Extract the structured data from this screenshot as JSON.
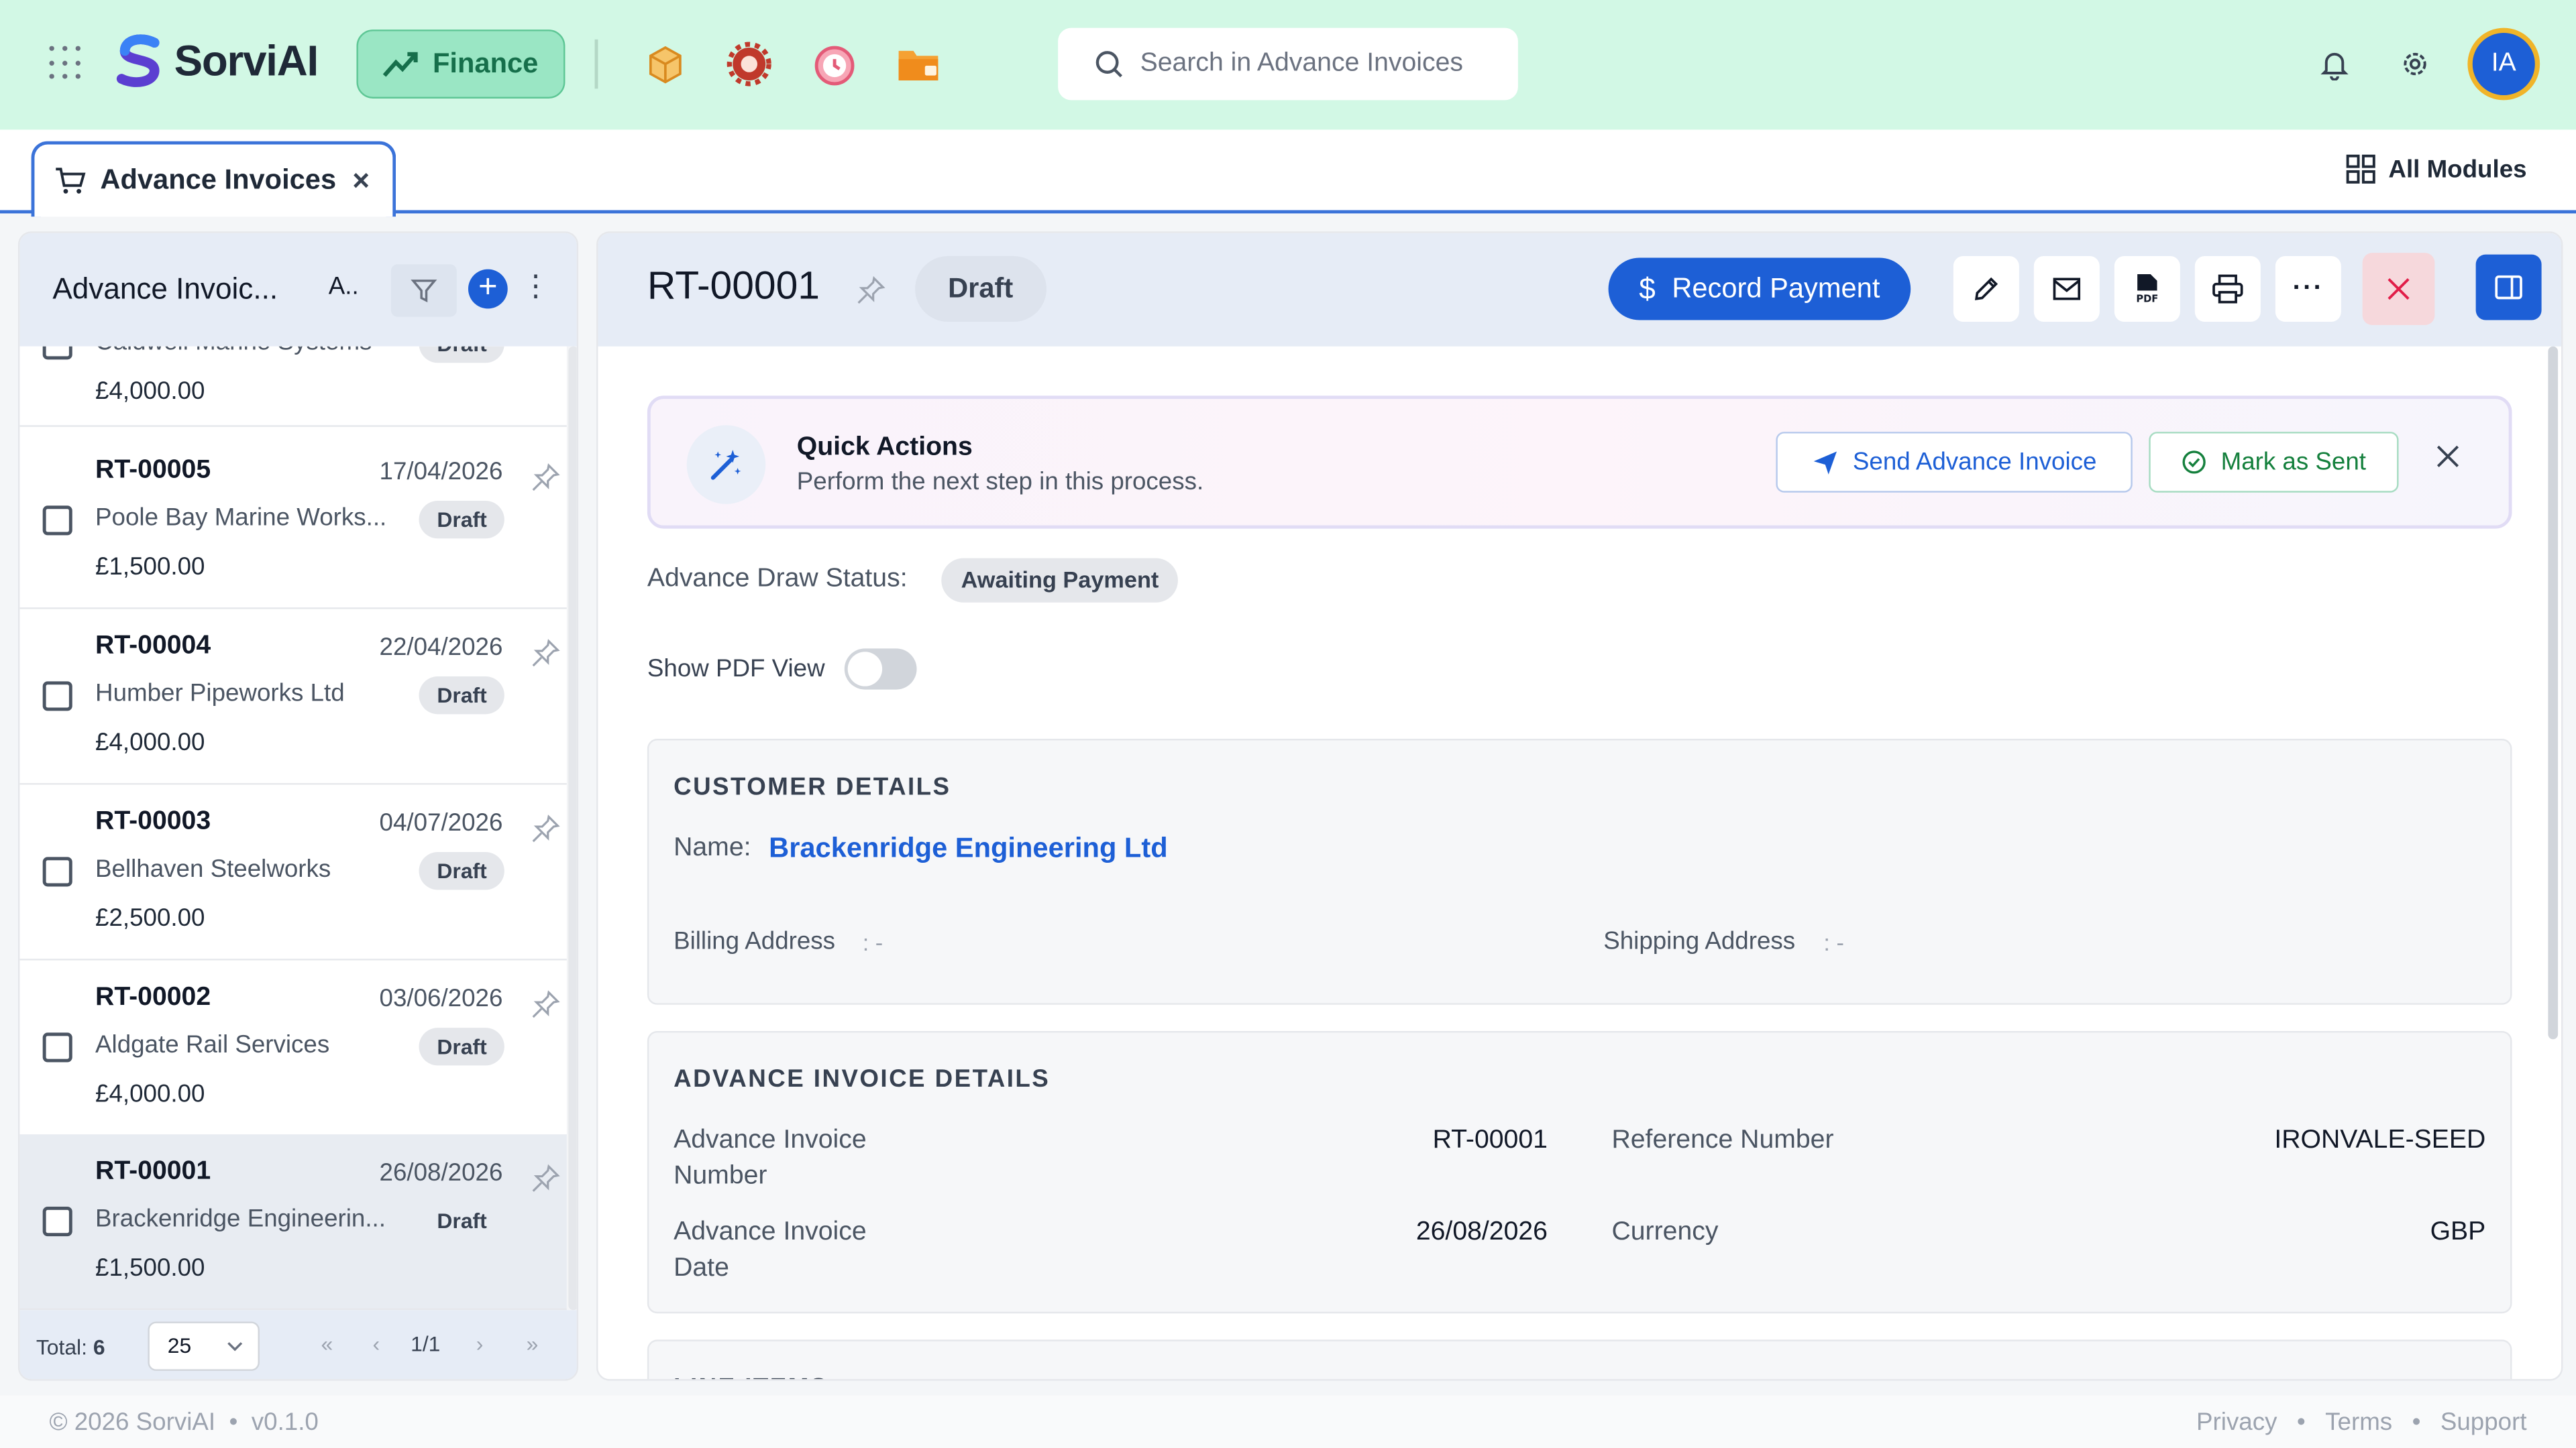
{
  "app": {
    "name": "SorviAI",
    "module": "Finance"
  },
  "search": {
    "placeholder": "Search in Advance Invoices"
  },
  "user": {
    "initials": "IA"
  },
  "tabs": {
    "active": "Advance Invoices",
    "all_modules": "All Modules"
  },
  "list_panel": {
    "title": "Advance Invoic...",
    "view_label": "A..",
    "items": [
      {
        "id": "",
        "date": "",
        "customer": "Caldwell Marine Systems",
        "status": "Draft",
        "amount": "£4,000.00"
      },
      {
        "id": "RT-00005",
        "date": "17/04/2026",
        "customer": "Poole Bay Marine Works...",
        "status": "Draft",
        "amount": "£1,500.00"
      },
      {
        "id": "RT-00004",
        "date": "22/04/2026",
        "customer": "Humber Pipeworks Ltd",
        "status": "Draft",
        "amount": "£4,000.00"
      },
      {
        "id": "RT-00003",
        "date": "04/07/2026",
        "customer": "Bellhaven Steelworks",
        "status": "Draft",
        "amount": "£2,500.00"
      },
      {
        "id": "RT-00002",
        "date": "03/06/2026",
        "customer": "Aldgate Rail Services",
        "status": "Draft",
        "amount": "£4,000.00"
      },
      {
        "id": "RT-00001",
        "date": "26/08/2026",
        "customer": "Brackenridge Engineerin...",
        "status": "Draft",
        "amount": "£1,500.00"
      }
    ],
    "footer": {
      "total_label": "Total:",
      "total_value": "6",
      "page_size": "25",
      "page": "1/1"
    }
  },
  "detail": {
    "id": "RT-00001",
    "status": "Draft",
    "record_payment": "Record Payment",
    "quick_actions": {
      "title": "Quick Actions",
      "subtitle": "Perform the next step in this process.",
      "send": "Send Advance Invoice",
      "mark_sent": "Mark as Sent"
    },
    "draw_status_label": "Advance Draw Status:",
    "draw_status": "Awaiting Payment",
    "pdf_toggle_label": "Show PDF View",
    "customer": {
      "heading": "CUSTOMER DETAILS",
      "name_label": "Name:",
      "name": "Brackenridge Engineering Ltd",
      "billing_label": "Billing Address",
      "billing_value": ": -",
      "shipping_label": "Shipping Address",
      "shipping_value": ": -"
    },
    "invoice": {
      "heading": "ADVANCE INVOICE DETAILS",
      "number_label_1": "Advance Invoice",
      "number_label_2": "Number",
      "number": "RT-00001",
      "ref_label": "Reference Number",
      "ref": "IRONVALE-SEED",
      "date_label_1": "Advance Invoice",
      "date_label_2": "Date",
      "date": "26/08/2026",
      "currency_label": "Currency",
      "currency": "GBP"
    },
    "next_section": "LINE ITEMS"
  },
  "footer": {
    "copyright": "© 2026 SorviAI",
    "version": "v0.1.0",
    "links": [
      "Privacy",
      "Terms",
      "Support"
    ]
  },
  "colors": {
    "accent": "#1d5fd6",
    "topbar": "#d2f8e5",
    "finance": "#9ae6c4"
  },
  "icons": [
    "apps-grid-icon",
    "logo-icon",
    "trend-icon",
    "box-icon",
    "gear-red-icon",
    "clock-pink-icon",
    "folder-orange-icon",
    "search-icon",
    "bell-icon",
    "settings-icon",
    "cart-icon",
    "close-icon",
    "modules-grid-icon",
    "filter-icon",
    "plus-icon",
    "more-icon",
    "pin-icon",
    "dollar-icon",
    "edit-icon",
    "mail-icon",
    "pdf-icon",
    "print-icon",
    "cancel-icon",
    "side-panel-icon",
    "magic-wand-icon",
    "send-icon",
    "check-circle-icon"
  ]
}
